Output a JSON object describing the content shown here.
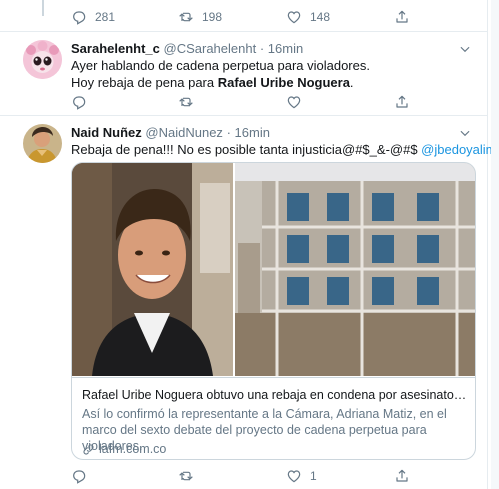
{
  "top_actions": {
    "reply_count": "281",
    "retweet_count": "198",
    "like_count": "148"
  },
  "tweet1": {
    "name": "Sarahelenht_c",
    "handle": "@CSarahelenht",
    "dot": "·",
    "time": "16min",
    "line1": "Ayer hablando de cadena perpetua para violadores.",
    "line2_prefix": " Hoy rebaja de pena para ",
    "line2_bold": "Rafael Uribe Noguera",
    "line2_suffix": "."
  },
  "tweet2": {
    "name": "Naid Nuñez",
    "handle": "@NaidNunez",
    "dot": "·",
    "time": "16min",
    "text": "Rebaja de pena!!! No es posible tanta injusticia@#$_&-@#$ ",
    "mention": "@jbedoyalima",
    "card": {
      "title": "Rafael Uribe Noguera obtuvo una rebaja en condena por asesinato de Y...",
      "desc": "Así lo confirmó la representante a la Cámara, Adriana Matiz, en el marco del sexto debate del proyecto de cadena perpetua para violadores.",
      "domain": "lafm.com.co"
    },
    "actions": {
      "retweet_count": "1"
    }
  },
  "colors": {
    "accent": "#1b95e0",
    "muted": "#657786",
    "border": "#e6ecf0"
  },
  "icons": [
    "reply-icon",
    "retweet-icon",
    "like-icon",
    "share-icon",
    "chevron-down-icon",
    "link-icon"
  ]
}
